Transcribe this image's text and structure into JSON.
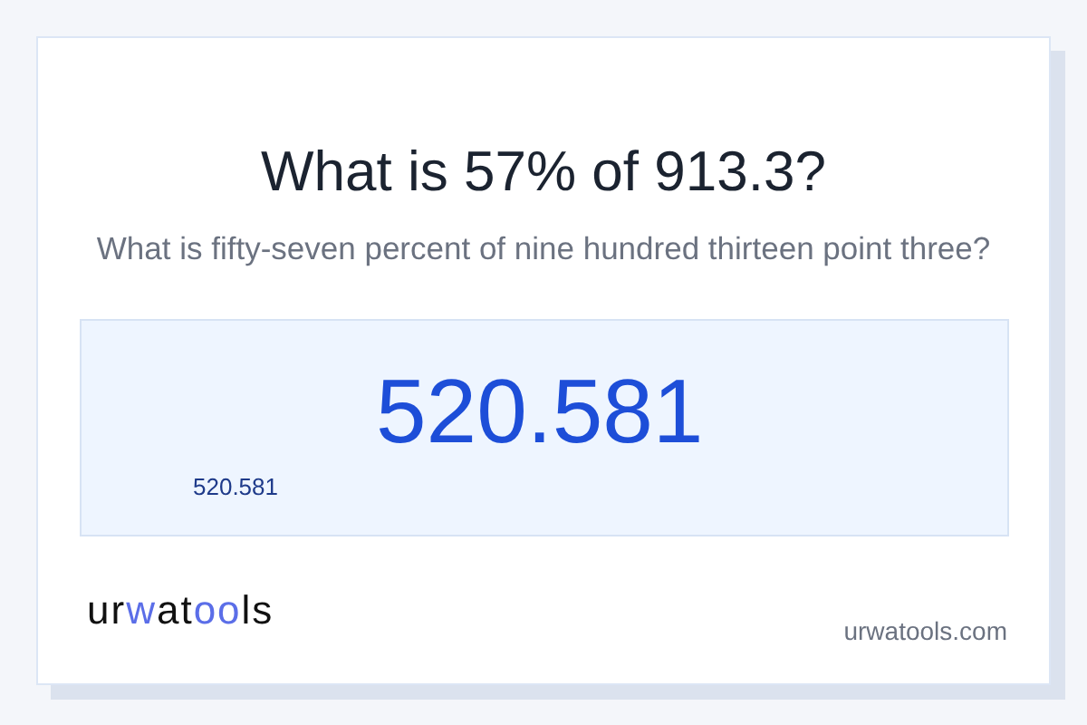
{
  "title": "What is 57% of 913.3?",
  "subtitle": "What is fifty-seven percent of nine hundred thirteen point three?",
  "result": {
    "value": "520.581",
    "caption": "520.581"
  },
  "logo": [
    {
      "text": "ur",
      "accent": false
    },
    {
      "text": "w",
      "accent": true
    },
    {
      "text": "at",
      "accent": false
    },
    {
      "text": "oo",
      "accent": true
    },
    {
      "text": "ls",
      "accent": false
    }
  ],
  "domain": "urwatools.com"
}
